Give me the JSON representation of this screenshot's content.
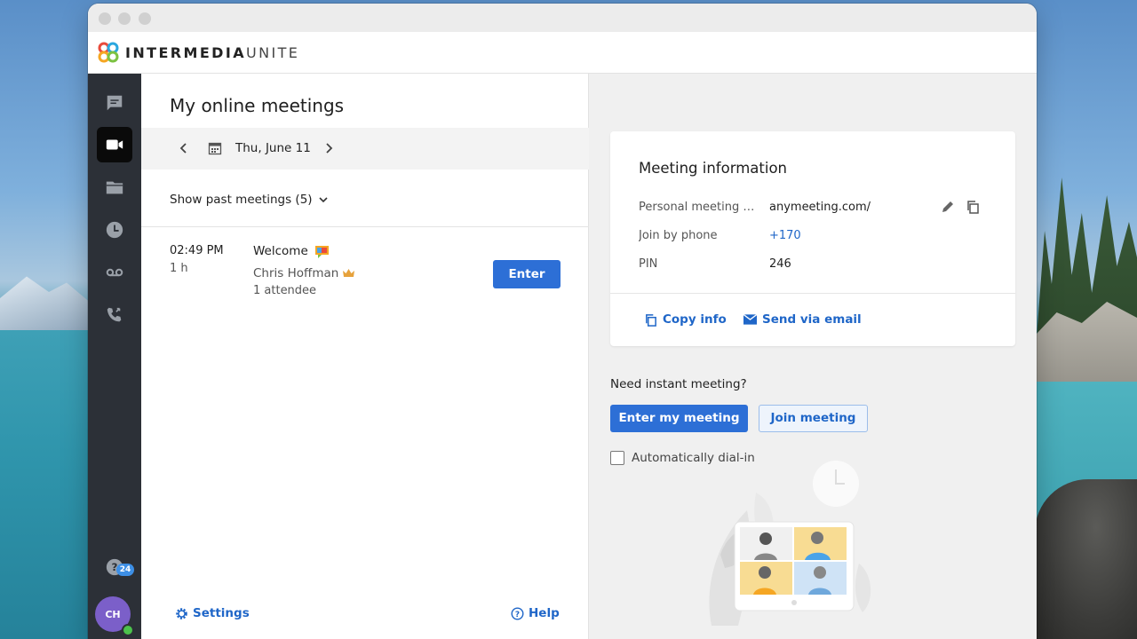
{
  "app": {
    "brand_bold": "INTERMEDIA",
    "brand_light": "UNITE"
  },
  "sidebar": {
    "items": [
      {
        "name": "chat",
        "icon": "chat-icon",
        "active": false
      },
      {
        "name": "meetings",
        "icon": "video-camera-icon",
        "active": true
      },
      {
        "name": "files",
        "icon": "folder-icon",
        "active": false
      },
      {
        "name": "history",
        "icon": "clock-icon",
        "active": false
      },
      {
        "name": "voicemail",
        "icon": "voicemail-icon",
        "active": false
      },
      {
        "name": "calls",
        "icon": "phone-forward-icon",
        "active": false
      }
    ],
    "help_badge": "24",
    "avatar_initials": "CH"
  },
  "meetings": {
    "title": "My online meetings",
    "date": "Thu, June 11",
    "past_label": "Show past meetings (5)",
    "items": [
      {
        "time": "02:49 PM",
        "duration": "1 h",
        "title": "Welcome",
        "host": "Chris Hoffman",
        "attendees": "1 attendee",
        "enter_label": "Enter"
      }
    ],
    "settings_label": "Settings",
    "help_label": "Help"
  },
  "info": {
    "title": "Meeting information",
    "rows": [
      {
        "label": "Personal meeting URL",
        "value": "anymeeting.com/c"
      },
      {
        "label": "Join by phone",
        "value": "+170"
      },
      {
        "label": "PIN",
        "value": "246"
      }
    ],
    "copy_label": "Copy info",
    "email_label": "Send via email"
  },
  "instant": {
    "title": "Need instant meeting?",
    "enter_label": "Enter my meeting",
    "join_label": "Join meeting",
    "auto_dial_label": "Automatically dial-in"
  },
  "colors": {
    "accent": "#2d6fd6",
    "sidebar": "#2c3037",
    "link": "#1f66c8"
  }
}
